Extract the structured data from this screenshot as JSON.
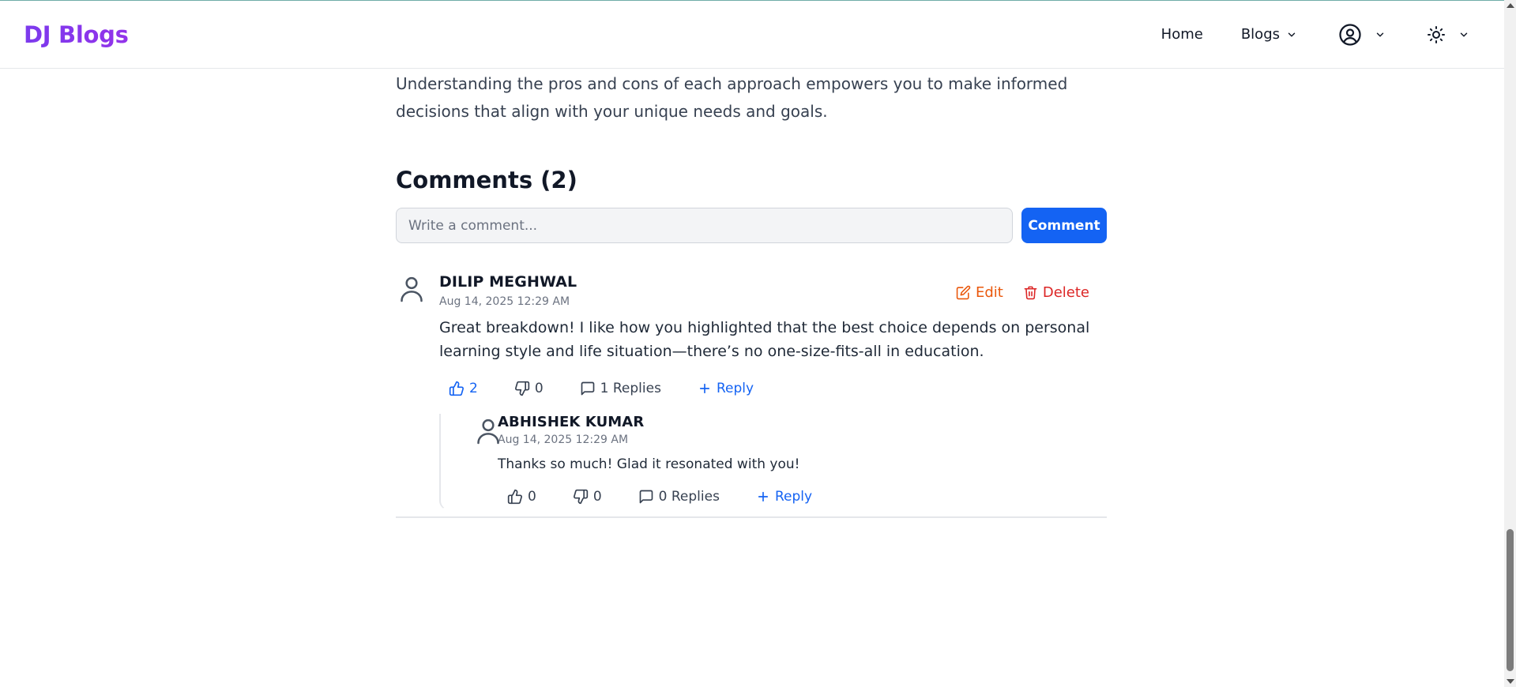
{
  "navbar": {
    "brand": "DJ Blogs",
    "home_label": "Home",
    "blogs_label": "Blogs",
    "user_icon": "user-circle-icon",
    "theme_icon": "sun-icon"
  },
  "article": {
    "closing_paragraph": "Understanding the pros and cons of each approach empowers you to make informed decisions that align with your unique needs and goals."
  },
  "comments": {
    "heading": "Comments (2)",
    "input_placeholder": "Write a comment...",
    "submit_label": "Comment",
    "items": [
      {
        "author": "DILIP MEGHWAL",
        "date": "Aug 14, 2025 12:29 AM",
        "text": "Great breakdown! I like how you highlighted that the best choice depends on personal learning style and life situation—there’s no one-size-fits-all in education.",
        "edit_label": "Edit",
        "delete_label": "Delete",
        "likes": "2",
        "dislikes": "0",
        "replies_label": "1 Replies",
        "reply_label": "Reply",
        "replies": [
          {
            "author": "ABHISHEK KUMAR",
            "date": "Aug 14, 2025 12:29 AM",
            "text": "Thanks so much! Glad it resonated with you!",
            "likes": "0",
            "dislikes": "0",
            "replies_label": "0 Replies",
            "reply_label": "Reply"
          }
        ]
      }
    ]
  },
  "colors": {
    "brand_gradient_start": "#7c3aed",
    "brand_gradient_end": "#9333ea",
    "primary": "#1463f3",
    "edit": "#ea580c",
    "delete": "#dc2626"
  }
}
